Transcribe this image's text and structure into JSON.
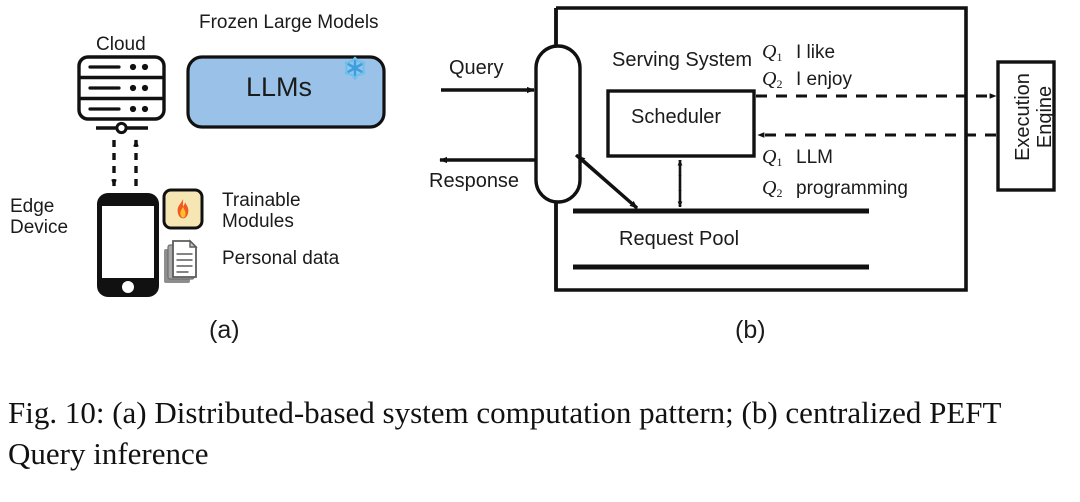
{
  "figure": {
    "caption": "Fig. 10: (a) Distributed-based system computation pattern; (b) centralized PEFT Query inference",
    "sublabel_a": "(a)",
    "sublabel_b": "(b)"
  },
  "panel_a": {
    "cloud_label": "Cloud",
    "frozen_label": "Frozen Large Models",
    "llms_box_text": "LLMs",
    "llms_box_fill": "#9AC2E8",
    "llms_box_stroke": "#111111",
    "snowflake_icon": "snowflake-icon",
    "snowflake_color": "#3C9FE0",
    "edge_device_label": "Edge\nDevice",
    "edge_device_label_line1": "Edge",
    "edge_device_label_line2": "Device",
    "trainable_label_line1": "Trainable",
    "trainable_label_line2": "Modules",
    "trainable_icon": "fire-icon",
    "trainable_icon_fill": "#F6E6B4",
    "personal_data_label": "Personal data",
    "personal_data_icon": "documents-icon",
    "server_icon": "cloud-server-icon",
    "phone_icon": "smartphone-icon",
    "uplink_arrow": "dashed-arrow-up",
    "downlink_arrow": "dashed-arrow-down"
  },
  "panel_b": {
    "query_label": "Query",
    "response_label": "Response",
    "serving_system_label": "Serving System",
    "scheduler_label": "Scheduler",
    "request_pool_label": "Request Pool",
    "execution_engine_line1": "Execution",
    "execution_engine_line2": "Engine",
    "queue_rows": [
      {
        "id": "q1-like",
        "symbol": "Q",
        "subscript": "1",
        "text": "I like"
      },
      {
        "id": "q2-enjoy",
        "symbol": "Q",
        "subscript": "2",
        "text": "I enjoy"
      },
      {
        "id": "q1-llm",
        "symbol": "Q",
        "subscript": "1",
        "text": "LLM"
      },
      {
        "id": "q2-programming",
        "symbol": "Q",
        "subscript": "2",
        "text": "programming"
      }
    ],
    "arrows": {
      "query_in": "solid-arrow-right",
      "response_out": "solid-arrow-left",
      "dispatch_to_engine": "dashed-arrow-right",
      "return_from_engine": "dashed-arrow-left",
      "pool_to_scheduler": "dashed-arrow-up",
      "pool_to_scheduler_down": "dashed-arrow-down",
      "pill_to_pool": "solid-arrow-diagonal"
    }
  },
  "colors": {
    "stroke": "#111111",
    "background": "#ffffff",
    "llm_blue": "#9AC2E8",
    "fire_box": "#F6E6B4",
    "doc_gray": "#6E6E6E"
  }
}
